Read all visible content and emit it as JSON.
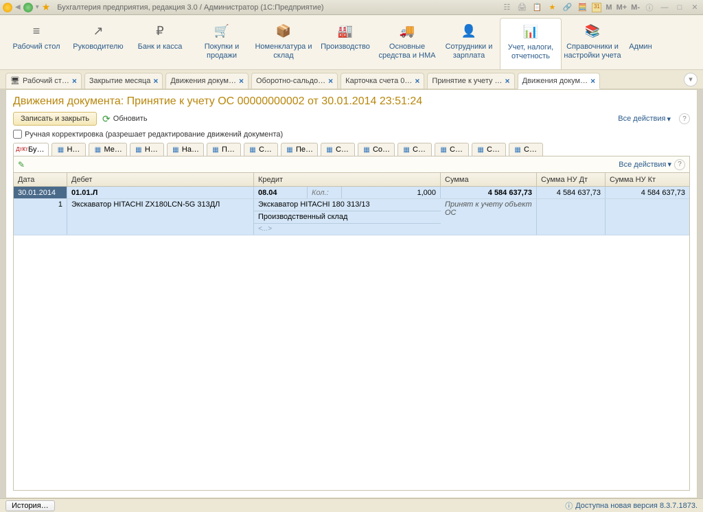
{
  "titlebar": {
    "title": "Бухгалтерия предприятия, редакция 3.0 / Администратор   (1С:Предприятие)",
    "m_buttons": [
      "M",
      "M+",
      "M-"
    ],
    "cal_text": "31"
  },
  "ribbon": [
    {
      "icon": "≡",
      "label": "Рабочий стол"
    },
    {
      "icon": "↗",
      "label": "Руководителю"
    },
    {
      "icon": "₽",
      "label": "Банк и касса"
    },
    {
      "icon": "🛒",
      "label": "Покупки и продажи"
    },
    {
      "icon": "📦",
      "label": "Номенклатура и склад"
    },
    {
      "icon": "🏭",
      "label": "Производство"
    },
    {
      "icon": "🚚",
      "label": "Основные средства и НМА"
    },
    {
      "icon": "👤",
      "label": "Сотрудники и зарплата"
    },
    {
      "icon": "📊",
      "label": "Учет, налоги, отчетность"
    },
    {
      "icon": "📚",
      "label": "Справочники и настройки учета"
    },
    {
      "icon": "",
      "label": "Админ"
    }
  ],
  "tabs": [
    {
      "label": "Рабочий ст…",
      "icon": "🖥"
    },
    {
      "label": "Закрытие месяца"
    },
    {
      "label": "Движения докум…"
    },
    {
      "label": "Оборотно-сальдо…"
    },
    {
      "label": "Карточка счета 0…"
    },
    {
      "label": "Принятие к учету …"
    },
    {
      "label": "Движения докум…",
      "active": true
    }
  ],
  "doc_title": "Движения документа: Принятие к учету ОС 00000000002 от 30.01.2014 23:51:24",
  "buttons": {
    "save_close": "Записать и закрыть",
    "refresh": "Обновить",
    "all_actions": "Все действия"
  },
  "checkbox_label": "Ручная корректировка (разрешает редактирование движений документа)",
  "subtabs": [
    "Бу…",
    "Н…",
    "Ме…",
    "Н…",
    "На…",
    "П…",
    "С…",
    "Пе…",
    "С…",
    "Со…",
    "С…",
    "С…",
    "С…",
    "С…"
  ],
  "grid": {
    "headers": {
      "date": "Дата",
      "debit": "Дебет",
      "credit": "Кредит",
      "sum": "Сумма",
      "nu_dt": "Сумма НУ Дт",
      "nu_kt": "Сумма НУ Кт"
    },
    "row1": {
      "date": "30.01.2014",
      "debit_acc": "01.01.Л",
      "credit_acc": "08.04",
      "kol_label": "Кол.:",
      "kol_val": "1,000",
      "sum": "4 584 637,73",
      "nu_dt": "4 584 637,73",
      "nu_kt": "4 584 637,73"
    },
    "row2": {
      "num": "1",
      "debit_text": "Экскаватор HITACHI ZX180LCN-5G  313ДЛ",
      "credit_text1": "Экскаватор HITACHI 180 313/13",
      "credit_text2": "Производственный склад",
      "credit_text3": "<...>",
      "sum_text": "Принят к учету объект ОС"
    }
  },
  "statusbar": {
    "history": "История…",
    "version": "Доступна новая версия 8.3.7.1873."
  }
}
